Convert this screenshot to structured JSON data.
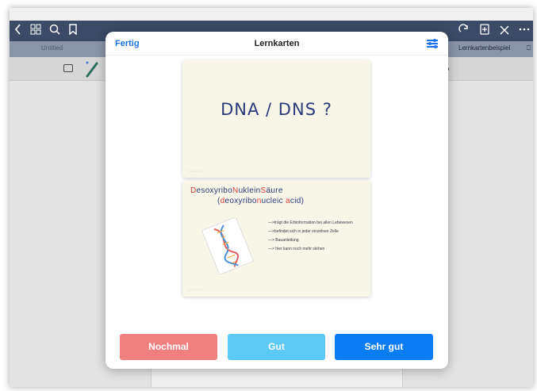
{
  "window": {
    "tabs": {
      "untitled": "Untitled",
      "active": "Lernkartenbeispiel"
    }
  },
  "toolbar_icons": [
    "back-chevron-icon",
    "grid-icon",
    "search-icon",
    "bookmark-icon",
    "redo-icon",
    "add-page-icon",
    "close-icon",
    "more-icon"
  ],
  "modal": {
    "done_label": "Fertig",
    "title": "Lernkarten",
    "settings_icon": "sliders-icon"
  },
  "card_front": {
    "question": "DNA / DNS ?"
  },
  "card_back": {
    "term_parts": [
      {
        "text": "D",
        "red": true
      },
      {
        "text": "esoxyribo",
        "red": false
      },
      {
        "text": "N",
        "red": true
      },
      {
        "text": "uklein",
        "red": false
      },
      {
        "text": "S",
        "red": true
      },
      {
        "text": "äure",
        "red": false
      }
    ],
    "translation_parts": [
      {
        "text": "(",
        "red": false
      },
      {
        "text": "d",
        "red": true
      },
      {
        "text": "eoxyribo",
        "red": false
      },
      {
        "text": "n",
        "red": true
      },
      {
        "text": "ucleic ",
        "red": false
      },
      {
        "text": "a",
        "red": true
      },
      {
        "text": "cid)",
        "red": false
      }
    ],
    "bullets": [
      "—>trägt die Erbinformation bei allen Lebewesen",
      "—>befindet sich in jeder einzelnen Zelle",
      "—> Bauanleitung",
      "—> hier kann noch mehr stehen"
    ]
  },
  "buttons": {
    "again": "Nochmal",
    "good": "Gut",
    "very_good": "Sehr gut"
  },
  "colors": {
    "accent": "#1a73e8",
    "again": "#f08080",
    "good": "#5cc8f5",
    "very_good": "#0a7df5",
    "handwriting": "#2c3a7a",
    "highlight": "#e23b3b"
  }
}
